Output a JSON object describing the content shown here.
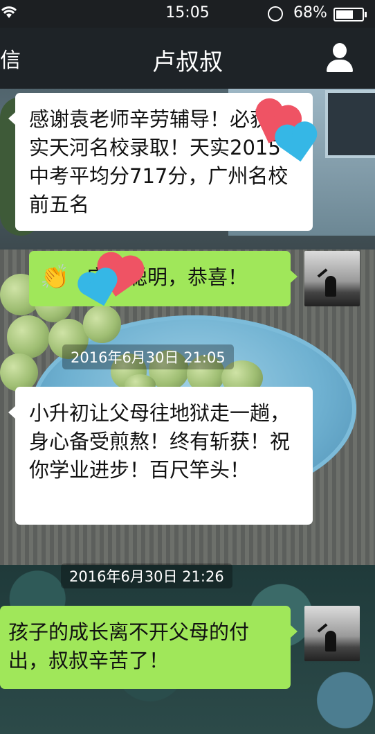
{
  "status_bar": {
    "time": "15:05",
    "battery_percent": "68%",
    "battery_level": 0.68,
    "icons": [
      "wifi-icon",
      "orientation-lock-icon",
      "battery-icon"
    ]
  },
  "nav_bar": {
    "back_label": "信",
    "title": "卢叔叔",
    "right_icon": "person-icon"
  },
  "messages": [
    {
      "direction": "incoming",
      "text": "感谢袁老师辛劳辅导！必获省实天河名校录取！天实2015中考平均分717分，广州名校前五名"
    },
    {
      "direction": "outgoing",
      "emoji": "👏",
      "text": "宝贝聪明，恭喜！"
    },
    {
      "type": "timestamp",
      "text": "2016年6月30日 21:05"
    },
    {
      "direction": "incoming",
      "text": "小升初让父母往地狱走一趟，身心备受煎熬！终有斩获！祝你学业进步！百尺竿头！"
    },
    {
      "type": "timestamp",
      "text": "2016年6月30日 21:26"
    },
    {
      "direction": "outgoing",
      "text": "孩子的成长离不开父母的付出，叔叔辛苦了！"
    }
  ],
  "colors": {
    "outgoing_bubble": "#a0e75a",
    "incoming_bubble": "#ffffff",
    "nav_background": "#1e2327",
    "sticker_red": "#ef5364",
    "sticker_blue": "#35b7e6"
  }
}
